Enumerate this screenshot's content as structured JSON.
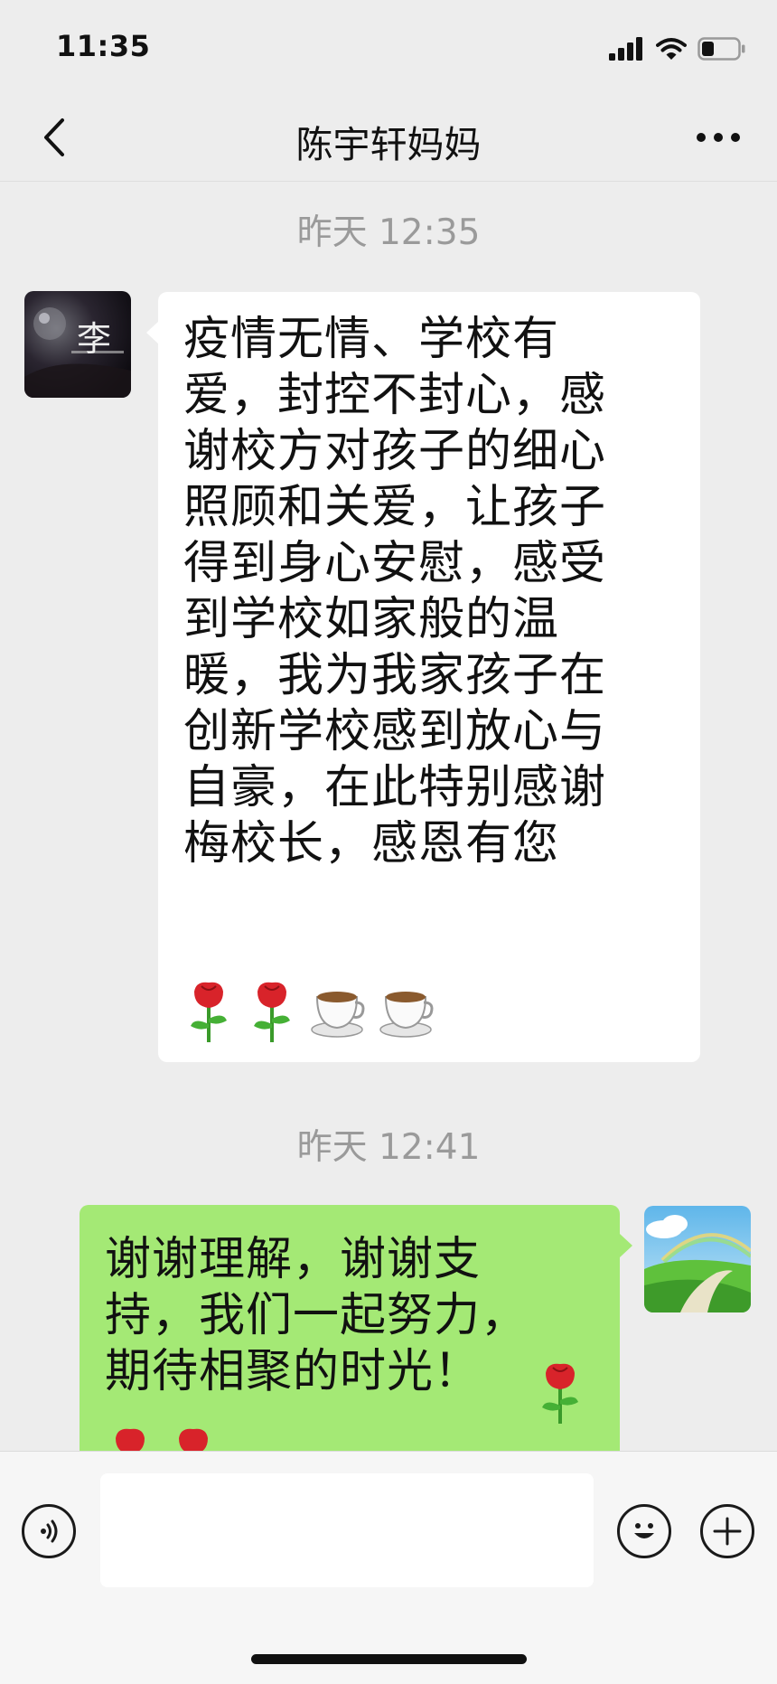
{
  "status_bar": {
    "time": "11:35"
  },
  "header": {
    "title": "陈宇轩妈妈"
  },
  "messages": [
    {
      "timestamp": "昨天 12:35",
      "sender": "contact",
      "avatar_text": "李",
      "text": "疫情无情、学校有\n爱，封控不封心，感\n谢校方对孩子的细心\n照顾和关爱，让孩子\n得到身心安慰，感受\n到学校如家般的温\n暖，我为我家孩子在\n创新学校感到放心与\n自豪，在此特别感谢\n梅校长，感恩有您",
      "emojis": [
        "rose-emoji",
        "rose-emoji",
        "coffee-emoji",
        "coffee-emoji"
      ]
    },
    {
      "timestamp": "昨天 12:41",
      "sender": "self",
      "text": "谢谢理解，谢谢支\n持，我们一起努力，\n期待相聚的时光！",
      "emojis": [
        "rose-emoji",
        "rose-emoji",
        "rose-emoji"
      ]
    }
  ],
  "input": {
    "value": ""
  },
  "colors": {
    "background": "#ededed",
    "incoming_bubble": "#ffffff",
    "outgoing_bubble": "#a4e975",
    "timestamp": "#9a9a9a"
  },
  "icons": {
    "back": "chevron-left-icon",
    "more": "ellipsis-icon",
    "voice": "voice-icon",
    "emoji": "smiley-icon",
    "plus": "plus-icon"
  }
}
